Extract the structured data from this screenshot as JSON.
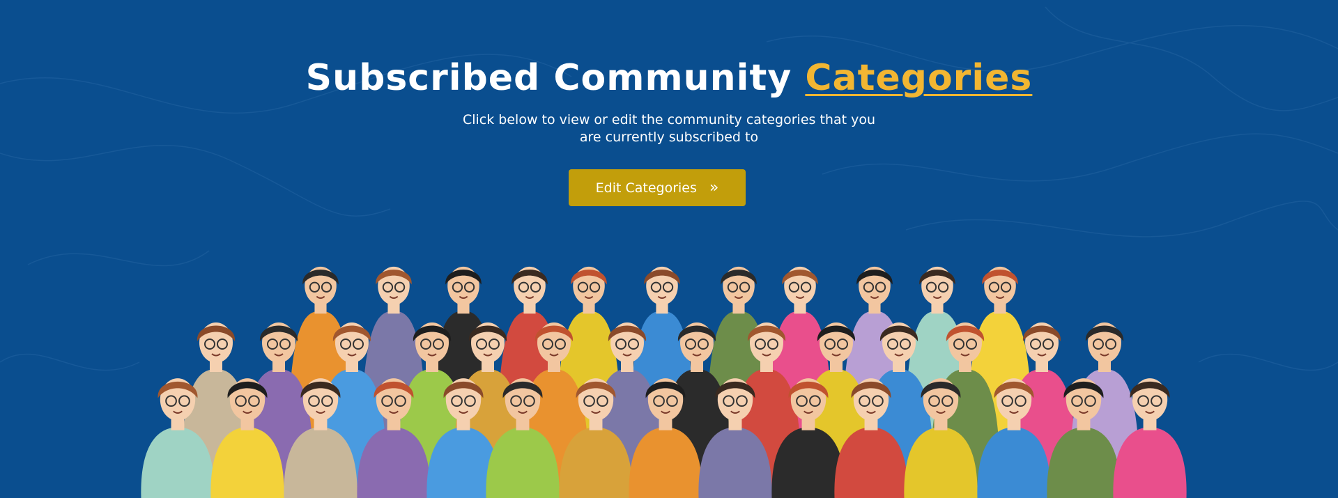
{
  "hero": {
    "title_main": "Subscribed Community",
    "title_accent": "Categories",
    "subtitle": "Click below to view or edit the community categories that you are currently subscribed to",
    "cta_label": "Edit Categories",
    "cta_icon": "double-chevron-right-icon"
  },
  "colors": {
    "background": "#0a4e8f",
    "accent": "#f2b632",
    "button": "#c29e0b",
    "text": "#ffffff"
  },
  "illustration": "crowd-of-people"
}
